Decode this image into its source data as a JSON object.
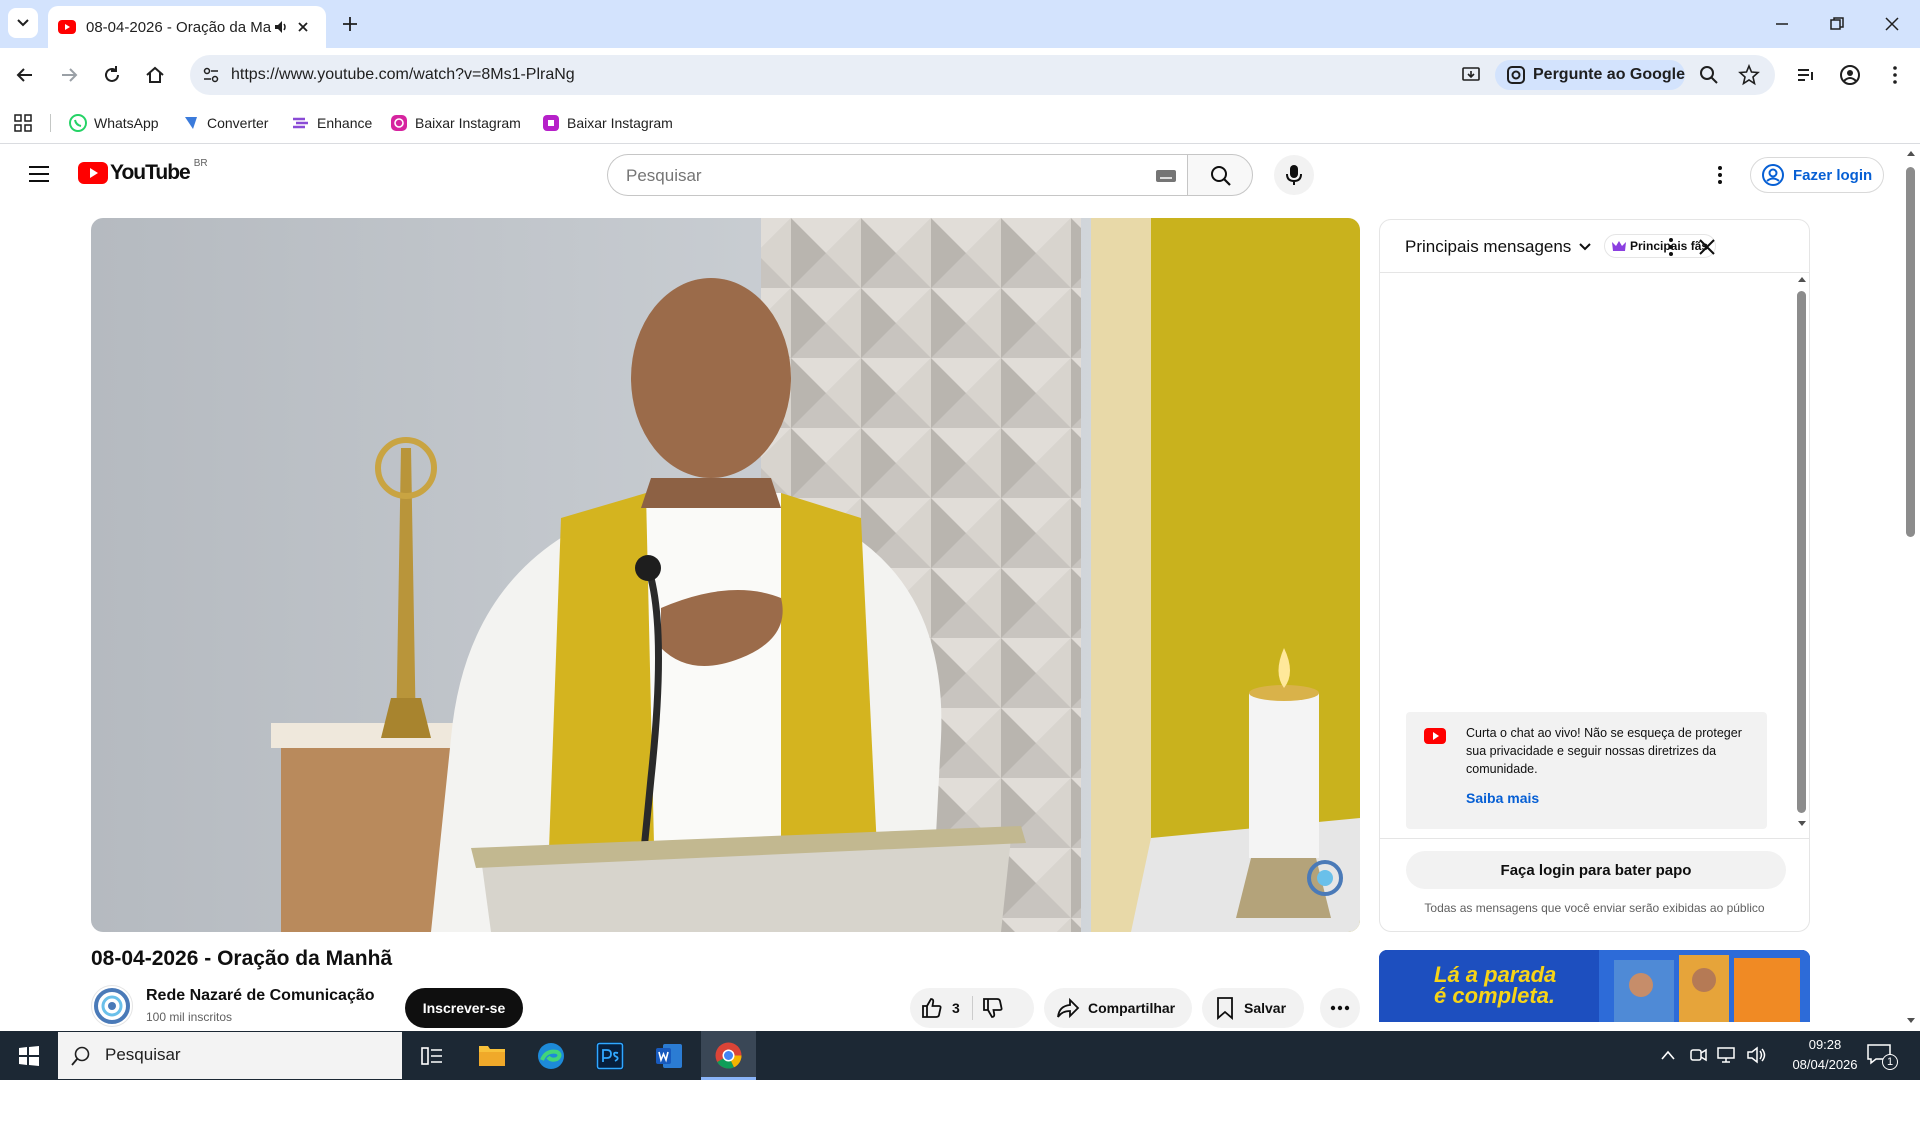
{
  "browser": {
    "tab_title": "08-04-2026 - Oração da Ma",
    "url": "https://www.youtube.com/watch?v=8Ms1-PlraNg",
    "ask_google": "Pergunte ao Google",
    "bookmarks": [
      "WhatsApp",
      "Converter",
      "Enhance",
      "Baixar Instagram",
      "Baixar Instagram"
    ]
  },
  "youtube": {
    "logo_text": "YouTube",
    "region": "BR",
    "search_placeholder": "Pesquisar",
    "login_label": "Fazer login"
  },
  "video": {
    "title": "08-04-2026 - Oração da Manhã",
    "channel_name": "Rede Nazaré de Comunicação",
    "subscribers": "100 mil inscritos",
    "subscribe_label": "Inscrever-se",
    "likes": "3",
    "share_label": "Compartilhar",
    "save_label": "Salvar"
  },
  "chat": {
    "title": "Principais mensagens",
    "fans_chip": "Principais fãs",
    "notice": "Curta o chat ao vivo! Não se esqueça de proteger sua privacidade e seguir nossas diretrizes da comunidade.",
    "learn_more": "Saiba mais",
    "login_to_chat": "Faça login para bater papo",
    "footer_note": "Todas as mensagens que você enviar serão exibidas ao público"
  },
  "ad": {
    "line1": "Lá a parada",
    "line2": "é completa."
  },
  "taskbar": {
    "search_placeholder": "Pesquisar",
    "time": "09:28",
    "date": "08/04/2026",
    "notification_count": "1"
  }
}
